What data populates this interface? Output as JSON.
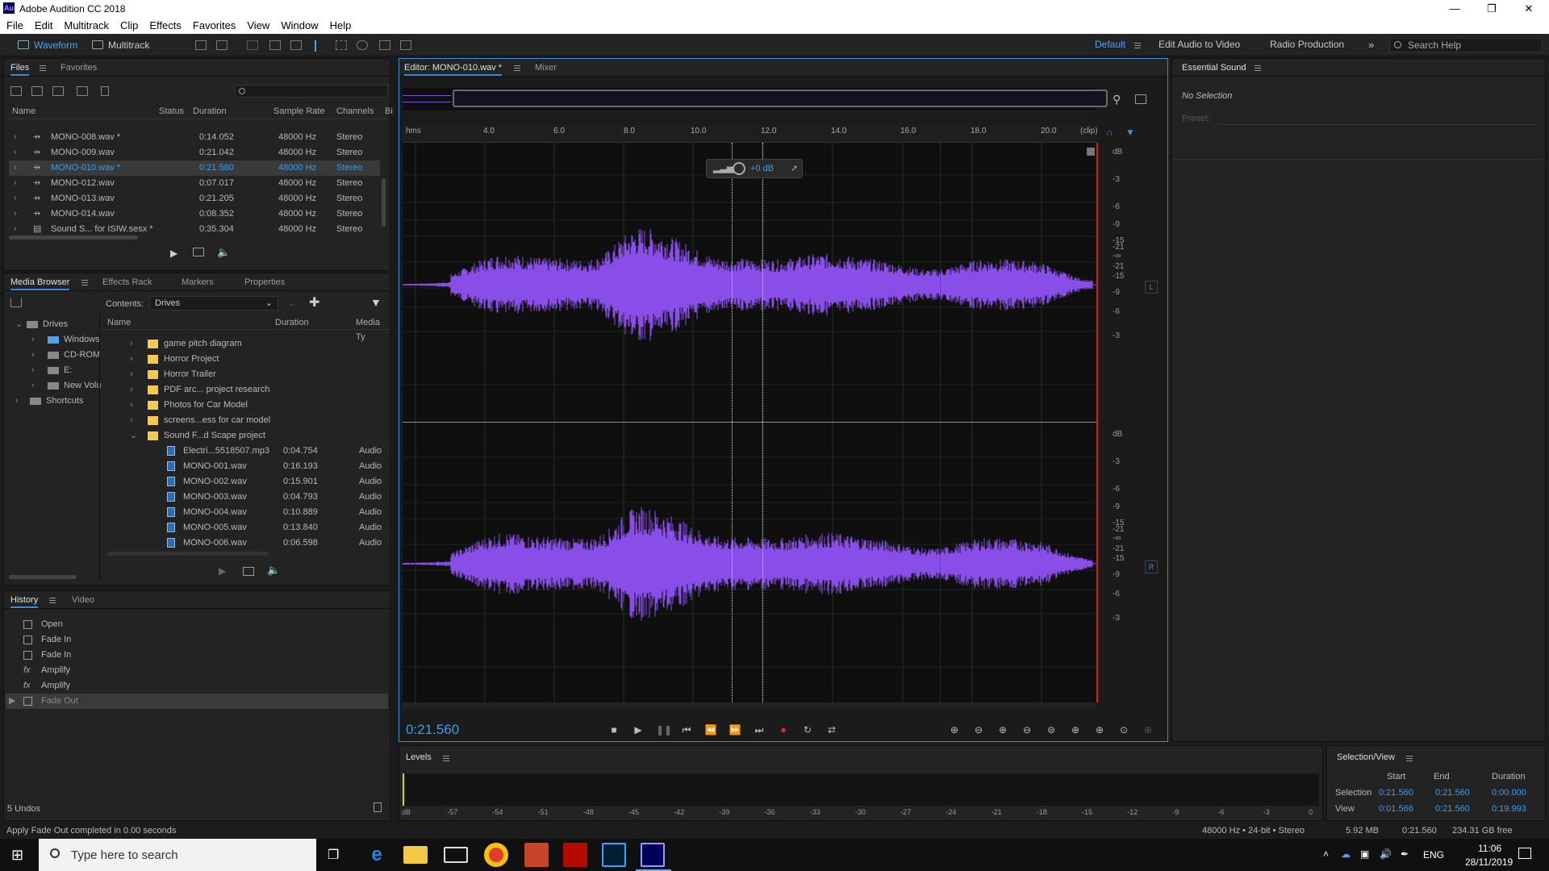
{
  "window": {
    "title": "Adobe Audition CC 2018",
    "logo": "Au"
  },
  "menu": [
    "File",
    "Edit",
    "Multitrack",
    "Clip",
    "Effects",
    "Favorites",
    "View",
    "Window",
    "Help"
  ],
  "toolbar": {
    "waveform": "Waveform",
    "multitrack": "Multitrack",
    "workspace_default": "Default",
    "workspace_edit_video": "Edit Audio to Video",
    "workspace_radio": "Radio Production",
    "search_placeholder": "Search Help"
  },
  "files": {
    "tab_files": "Files",
    "tab_favorites": "Favorites",
    "columns": [
      "Name",
      "Status",
      "Duration",
      "Sample Rate",
      "Channels",
      "Bi"
    ],
    "rows": [
      {
        "name": "MONO-008.wav *",
        "duration": "0:14.052",
        "rate": "48000 Hz",
        "channels": "Stereo"
      },
      {
        "name": "MONO-009.wav",
        "duration": "0:21.042",
        "rate": "48000 Hz",
        "channels": "Stereo"
      },
      {
        "name": "MONO-010.wav *",
        "duration": "0:21.560",
        "rate": "48000 Hz",
        "channels": "Stereo"
      },
      {
        "name": "MONO-012.wav",
        "duration": "0:07.017",
        "rate": "48000 Hz",
        "channels": "Stereo"
      },
      {
        "name": "MONO-013.wav",
        "duration": "0:21.205",
        "rate": "48000 Hz",
        "channels": "Stereo"
      },
      {
        "name": "MONO-014.wav",
        "duration": "0:08.352",
        "rate": "48000 Hz",
        "channels": "Stereo"
      },
      {
        "name": "Sound S... for ISIW.sesx *",
        "duration": "0:35.304",
        "rate": "48000 Hz",
        "channels": "Stereo"
      }
    ]
  },
  "media": {
    "tab_media": "Media Browser",
    "tab_effects": "Effects Rack",
    "tab_markers": "Markers",
    "tab_properties": "Properties",
    "contents_label": "Contents:",
    "contents_value": "Drives",
    "tree": [
      "Drives",
      "Windows",
      "CD-ROM",
      "E:",
      "New Volu",
      "Shortcuts"
    ],
    "columns": [
      "Name",
      "Duration",
      "Media Ty"
    ],
    "folders": [
      "game pitch diagram",
      "Horror Project",
      "Horror Trailer",
      "PDF arc... project research",
      "Photos for Car Model",
      "screens...ess for car model",
      "Sound F...d Scape project"
    ],
    "files": [
      {
        "name": "Electri...5518507.mp3",
        "duration": "0:04.754",
        "type": "Audio"
      },
      {
        "name": "MONO-001.wav",
        "duration": "0:16.193",
        "type": "Audio"
      },
      {
        "name": "MONO-002.wav",
        "duration": "0:15.901",
        "type": "Audio"
      },
      {
        "name": "MONO-003.wav",
        "duration": "0:04.793",
        "type": "Audio"
      },
      {
        "name": "MONO-004.wav",
        "duration": "0:10.889",
        "type": "Audio"
      },
      {
        "name": "MONO-005.wav",
        "duration": "0:13.840",
        "type": "Audio"
      },
      {
        "name": "MONO-006.wav",
        "duration": "0:06.598",
        "type": "Audio"
      }
    ]
  },
  "history": {
    "tab_history": "History",
    "tab_video": "Video",
    "items": [
      "Open",
      "Fade In",
      "Fade In",
      "Amplify",
      "Amplify",
      "Fade Out"
    ],
    "undos": "5 Undos"
  },
  "editor": {
    "tab_editor": "Editor: MONO-010.wav *",
    "tab_mixer": "Mixer",
    "timecode": "0:21.560",
    "hud_gain": "+0 dB",
    "ruler_unit": "hms",
    "ruler": [
      "4.0",
      "6.0",
      "8.0",
      "10.0",
      "12.0",
      "14.0",
      "16.0",
      "18.0",
      "20.0"
    ],
    "ruler_end": "(clip)",
    "db_top": [
      "dB",
      "-3",
      "-6",
      "-9",
      "-15",
      "-21",
      "-∞",
      "-21",
      "-15",
      "-9",
      "-6",
      "-3"
    ],
    "db_bottom": [
      "dB",
      "-3",
      "-6",
      "-9",
      "-15",
      "-21",
      "-∞",
      "-21",
      "-15",
      "-9",
      "-6",
      "-3"
    ],
    "ch_left": "L",
    "ch_right": "R",
    "wave_color": "#8a4ee8"
  },
  "essential": {
    "title": "Essential Sound",
    "no_selection": "No Selection",
    "preset_label": "Preset:"
  },
  "levels": {
    "title": "Levels",
    "scale": [
      "dB",
      "-57",
      "-54",
      "-51",
      "-48",
      "-45",
      "-42",
      "-39",
      "-36",
      "-33",
      "-30",
      "-27",
      "-24",
      "-21",
      "-18",
      "-15",
      "-12",
      "-9",
      "-6",
      "-3",
      "0"
    ]
  },
  "selview": {
    "title": "Selection/View",
    "col_start": "Start",
    "col_end": "End",
    "col_duration": "Duration",
    "selection_label": "Selection",
    "sel_start": "0:21.560",
    "sel_end": "0:21.560",
    "sel_dur": "0:00.000",
    "view_label": "View",
    "view_start": "0:01.566",
    "view_end": "0:21.560",
    "view_dur": "0:19.993"
  },
  "status": {
    "message": "Apply Fade Out completed in 0.00 seconds",
    "format": "48000 Hz • 24-bit • Stereo",
    "size": "5.92 MB",
    "duration": "0:21.560",
    "free": "234.31 GB free"
  },
  "taskbar": {
    "search_placeholder": "Type here to search",
    "lang": "ENG",
    "time": "11:06",
    "date": "28/11/2019"
  }
}
